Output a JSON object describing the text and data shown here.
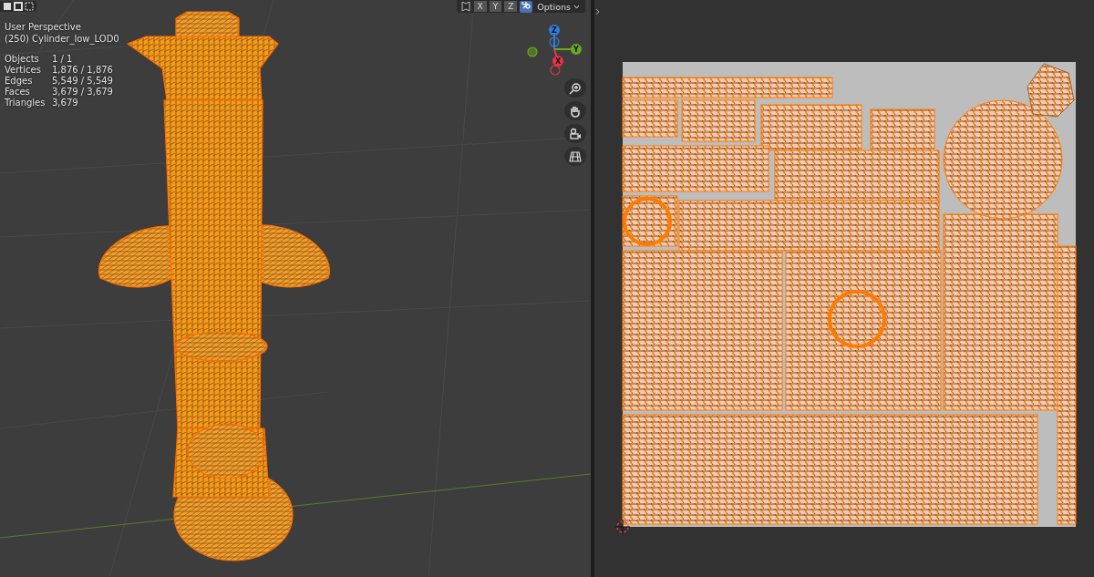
{
  "viewport": {
    "axis_toggles": [
      {
        "label": "X",
        "selected": false
      },
      {
        "label": "Y",
        "selected": false
      },
      {
        "label": "Z",
        "selected": false
      }
    ],
    "sync_selection": {
      "on": true
    },
    "options_menu": {
      "label": "Options"
    },
    "overlay": {
      "view_name": "User Perspective",
      "object_name": "(250) Cylinder_low_LOD0",
      "stats": [
        {
          "label": "Objects",
          "value": "1 / 1"
        },
        {
          "label": "Vertices",
          "value": "1,876 / 1,876"
        },
        {
          "label": "Edges",
          "value": "5,549 / 5,549"
        },
        {
          "label": "Faces",
          "value": "3,679 / 3,679"
        },
        {
          "label": "Triangles",
          "value": "3,679"
        }
      ]
    },
    "gizmo": {
      "axes": [
        {
          "label": "Z",
          "color": "#2f7fe0"
        },
        {
          "label": "Y",
          "color": "#6aa81e"
        },
        {
          "label": "X",
          "color": "#e8324a"
        }
      ]
    }
  }
}
